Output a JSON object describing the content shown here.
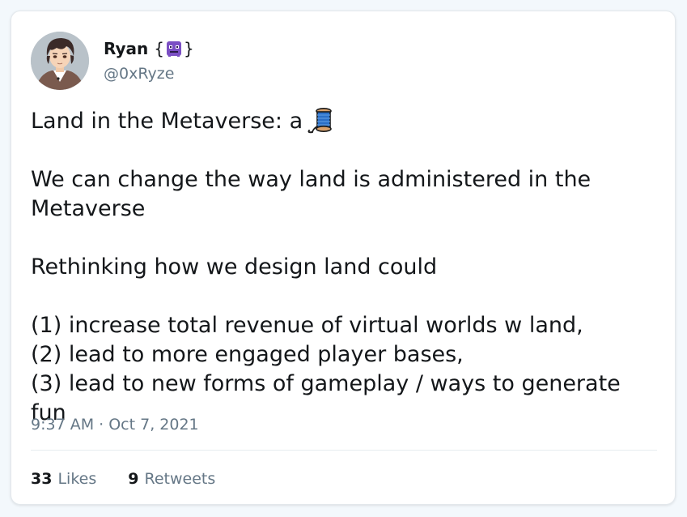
{
  "author": {
    "name": "Ryan",
    "brace_open": "{",
    "emoji": "alien-monster-icon",
    "brace_close": "}",
    "handle": "@0xRyze"
  },
  "tweet": {
    "lines": [
      "Land in the Metaverse: a",
      "We can change the way land is administered in the Metaverse",
      "Rethinking how we design land could",
      "(1) increase total revenue of virtual worlds w land,",
      "(2) lead to more engaged player bases,",
      "(3) lead to new forms of gameplay / ways to generate fun"
    ],
    "thread_emoji": "spool-of-thread-icon",
    "timestamp": "9:37 AM · Oct 7, 2021"
  },
  "stats": {
    "likes_count": "33",
    "likes_label": "Likes",
    "retweets_count": "9",
    "retweets_label": "Retweets"
  },
  "colors": {
    "text": "#14171a",
    "secondary": "#657786",
    "background": "#f3f8fc",
    "card": "#ffffff"
  }
}
